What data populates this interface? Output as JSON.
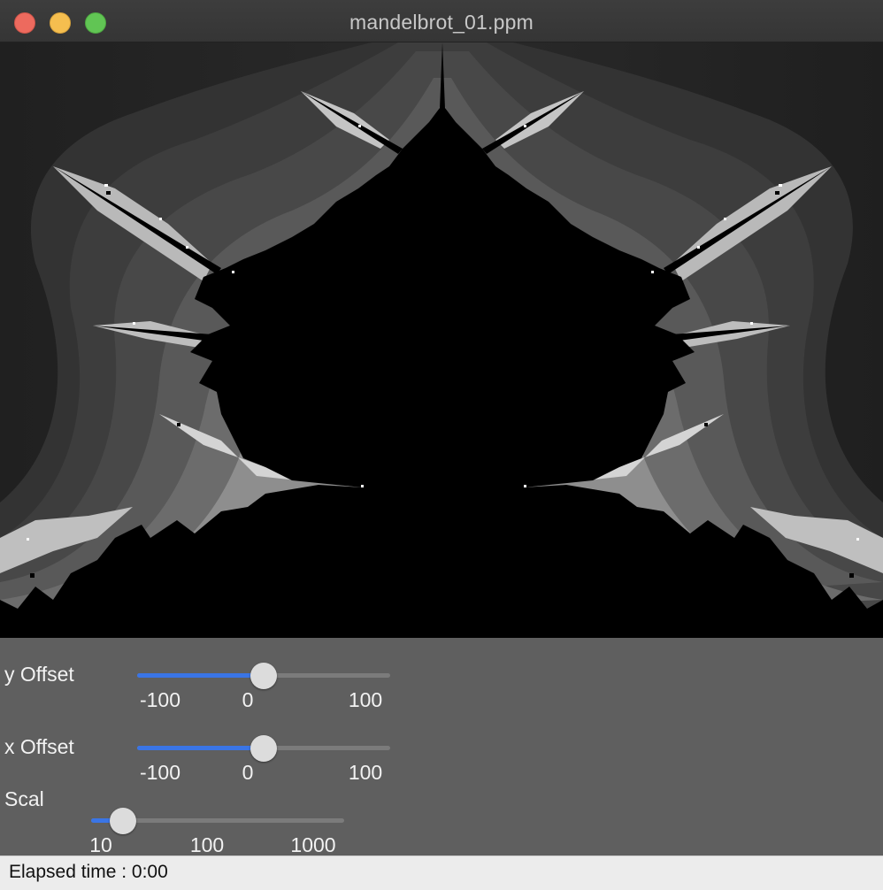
{
  "window": {
    "title": "mandelbrot_01.ppm",
    "colors": {
      "titlebar": "#3a3a3a",
      "controls_bg": "#5f5f5f",
      "accent": "#3a75e6"
    }
  },
  "controls": {
    "y_offset": {
      "label": "y Offset",
      "min": -100,
      "max": 100,
      "value": 0,
      "ticks": [
        "-100",
        "0",
        "100"
      ]
    },
    "x_offset": {
      "label": "x Offset",
      "min": -100,
      "max": 100,
      "value": 0,
      "ticks": [
        "-100",
        "0",
        "100"
      ]
    },
    "scale": {
      "label": "Scal",
      "value": 20,
      "ticks": [
        "10",
        "100",
        "1000"
      ]
    }
  },
  "status": {
    "elapsed": "Elapsed time : 0:00"
  }
}
